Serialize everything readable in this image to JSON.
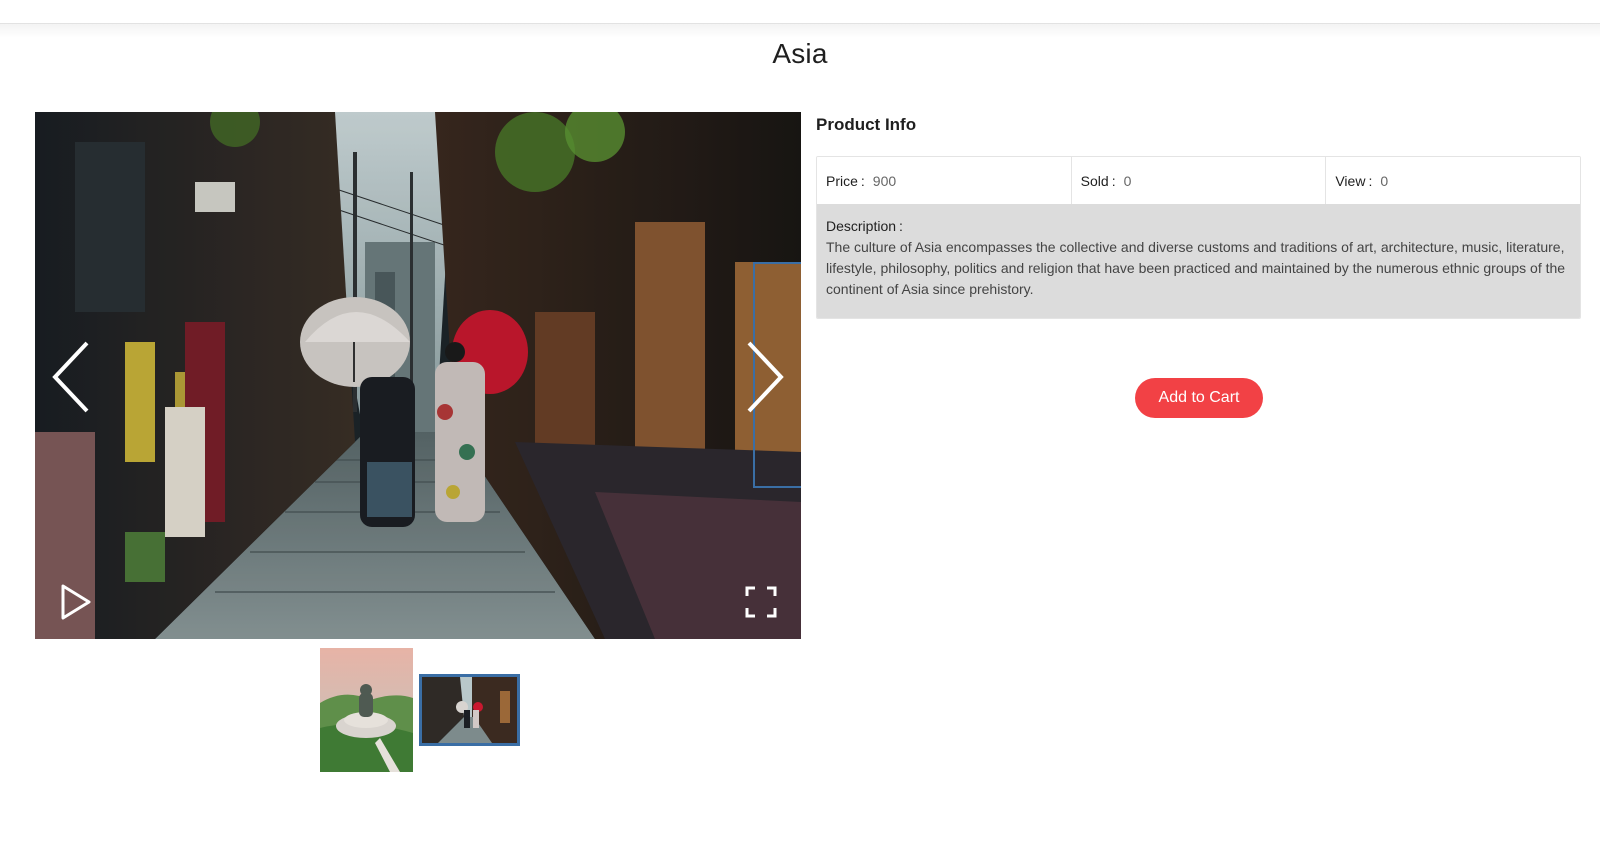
{
  "page": {
    "title": "Asia"
  },
  "gallery": {
    "current_image": "kyoto-street-umbrellas",
    "thumbnails": [
      {
        "subject": "big-buddha-statue",
        "selected": false
      },
      {
        "subject": "kyoto-street-umbrellas",
        "selected": true
      }
    ],
    "icons": {
      "prev": "chevron-left-icon",
      "next": "chevron-right-icon",
      "play": "play-icon",
      "fullscreen": "fullscreen-icon"
    }
  },
  "product_info": {
    "heading": "Product Info",
    "price_label": "Price",
    "price_value": "900",
    "sold_label": "Sold",
    "sold_value": "0",
    "view_label": "View",
    "view_value": "0",
    "colon": ":",
    "description_label": "Description",
    "description_text": "The culture of Asia encompasses the collective and diverse customs and traditions of art, architecture, music, literature, lifestyle, philosophy, politics and religion that have been practiced and maintained by the numerous ethnic groups of the continent of Asia since prehistory."
  },
  "actions": {
    "add_to_cart_label": "Add to Cart"
  },
  "colors": {
    "accent_button": "#f24145",
    "thumb_selected_border": "#3a6ea5",
    "description_bg": "#dcdcdc"
  }
}
